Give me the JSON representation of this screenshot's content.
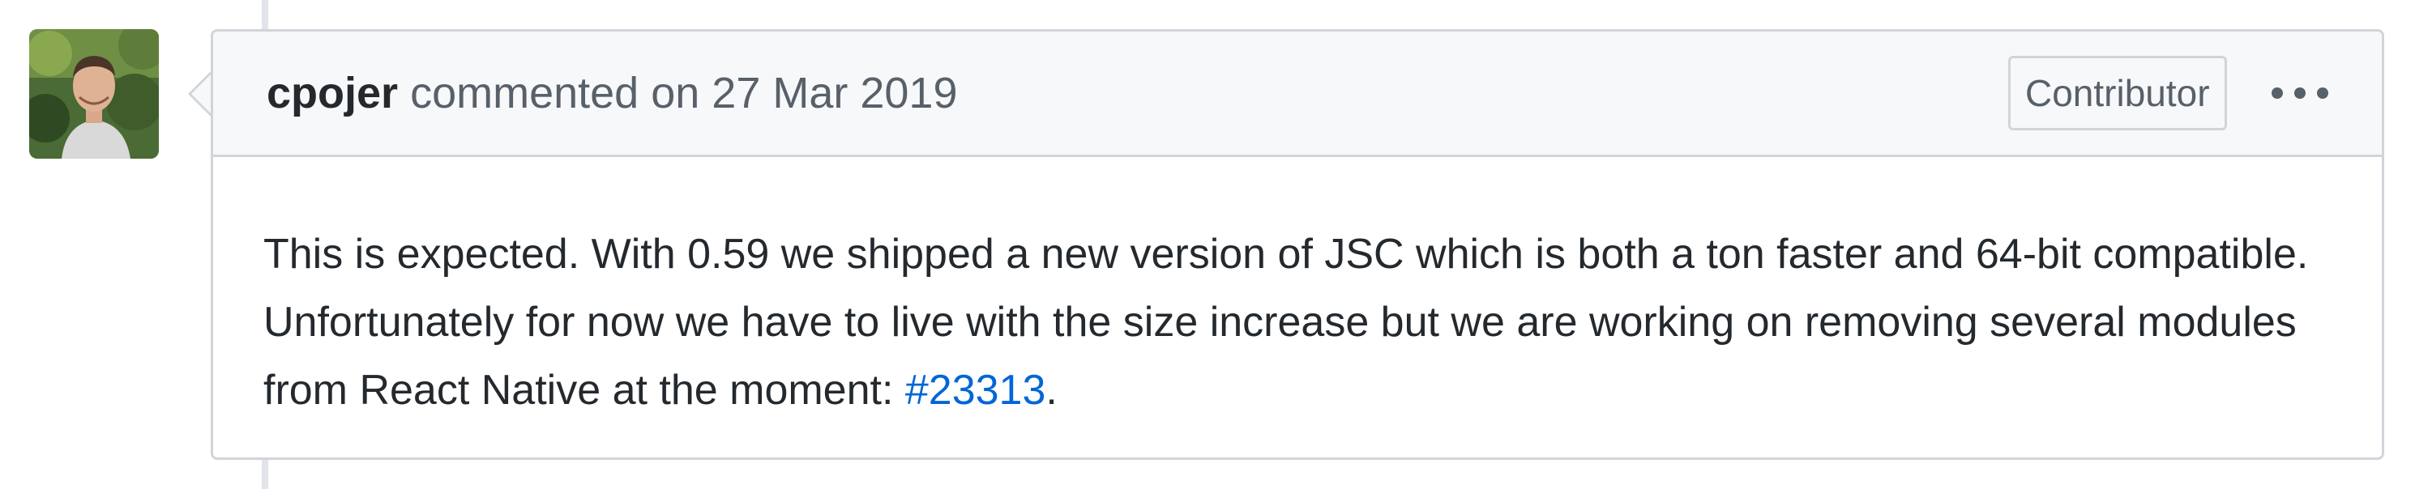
{
  "comment": {
    "author": "cpojer",
    "action": "commented on",
    "date": "27 Mar 2019",
    "badge": "Contributor",
    "body": {
      "text": "This is expected. With 0.59 we shipped a new version of JSC which is both a ton faster and 64-bit compatible. Unfortunately for now we have to live with the size increase but we are working on removing several modules from React Native at the moment: ",
      "link_text": "#23313",
      "trailing": "."
    }
  },
  "icons": {
    "avatar": "avatar-photo",
    "menu": "kebab-menu-icon"
  },
  "colors": {
    "link": "#0366d6",
    "border": "#d1d5da",
    "header_bg": "#f6f8fa",
    "text": "#24292e",
    "muted": "#586069"
  }
}
